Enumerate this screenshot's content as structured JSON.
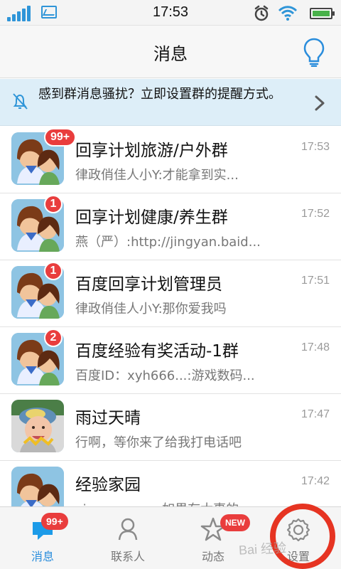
{
  "status_bar": {
    "time": "17:53",
    "icons": [
      "signal-icon",
      "image-icon",
      "alarm-icon",
      "wifi-icon",
      "battery-icon"
    ]
  },
  "header": {
    "title": "消息",
    "action_icon": "lightbulb-icon"
  },
  "notice": {
    "text": "感到群消息骚扰？立即设置群的提醒方式。",
    "icon": "muted-bell-icon",
    "action_icon": "chevron-right-icon"
  },
  "messages": [
    {
      "name": "回享计划旅游/户外群",
      "preview": "律政俏佳人小Y:才能拿到实...",
      "time": "17:53",
      "badge": "99+",
      "avatar": "group-avatar"
    },
    {
      "name": "回享计划健康/养生群",
      "preview": "燕（严）:http://jingyan.baid...",
      "time": "17:52",
      "badge": "1",
      "avatar": "group-avatar"
    },
    {
      "name": "百度回享计划管理员",
      "preview": "律政俏佳人小Y:那你爱我吗",
      "time": "17:51",
      "badge": "1",
      "avatar": "group-avatar"
    },
    {
      "name": "百度经验有奖活动-1群",
      "preview": "百度ID：xyh666...:游戏数码...",
      "time": "17:48",
      "badge": "2",
      "avatar": "group-avatar"
    },
    {
      "name": "雨过天晴",
      "preview": "行啊，等你来了给我打电话吧",
      "time": "17:47",
      "badge": "",
      "avatar": "child-avatar"
    },
    {
      "name": "经验家园",
      "preview": "xiaoconcouw:如果有太事的",
      "time": "17:42",
      "badge": "",
      "avatar": "group-avatar"
    }
  ],
  "tabs": [
    {
      "label": "消息",
      "icon": "message-icon",
      "badge": "99+",
      "active": true
    },
    {
      "label": "联系人",
      "icon": "contact-icon",
      "badge": "",
      "active": false
    },
    {
      "label": "动态",
      "icon": "star-icon",
      "badge": "NEW",
      "active": false
    },
    {
      "label": "设置",
      "icon": "gear-icon",
      "badge": "",
      "active": false
    }
  ],
  "watermark": "Bai 经验",
  "colors": {
    "accent_blue": "#2a8ddc",
    "badge_red": "#e93d3d",
    "notice_bg": "#ddeef8",
    "highlight_red": "#e63422"
  }
}
